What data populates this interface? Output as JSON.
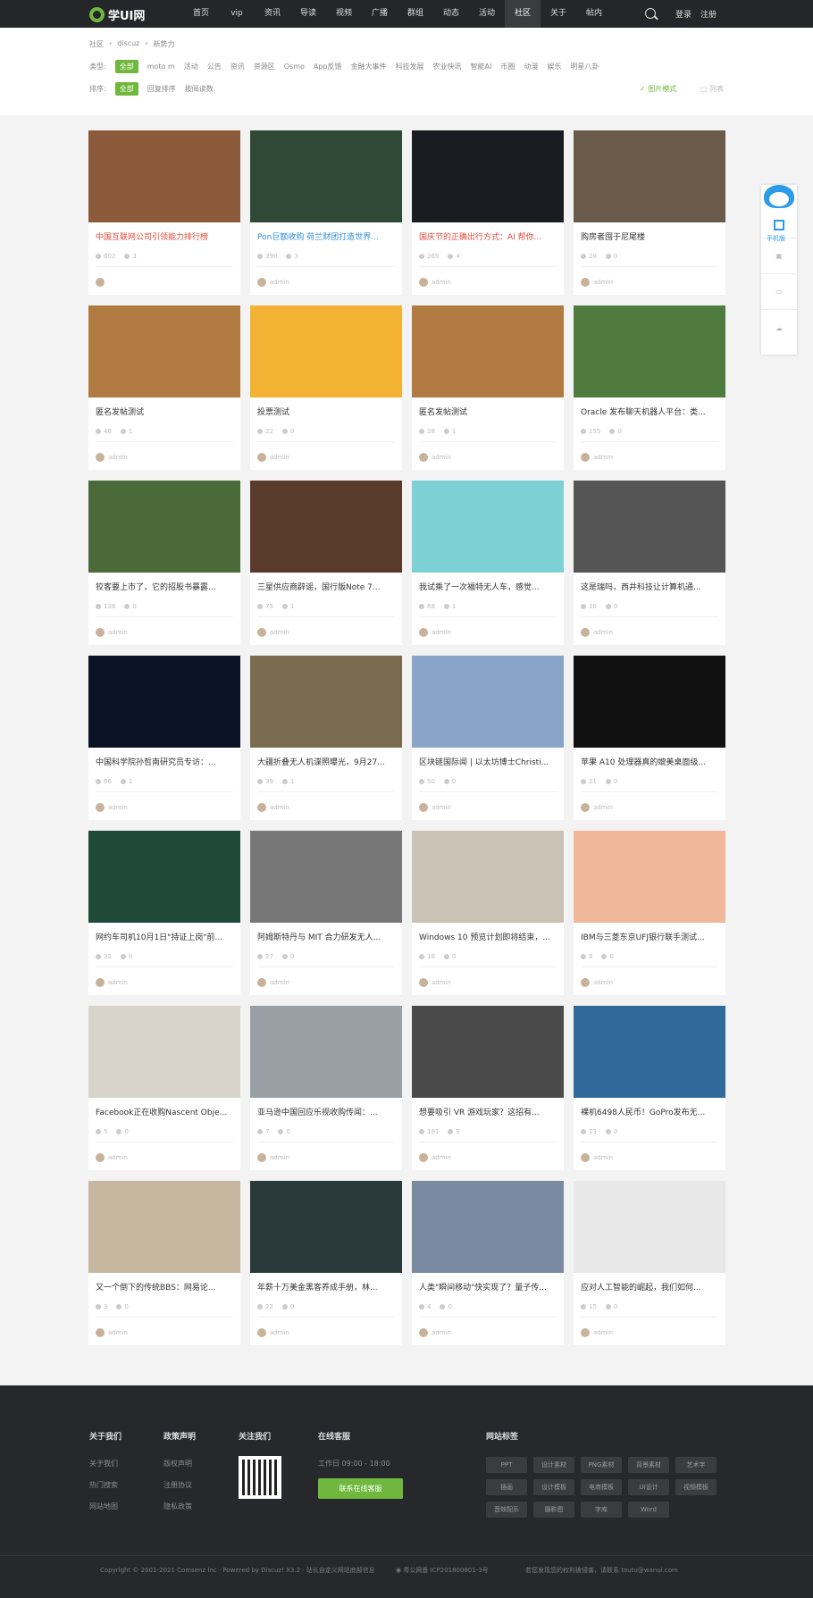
{
  "site": {
    "logo": "学UI网"
  },
  "nav": [
    "首页",
    "vip",
    "资讯",
    "导读",
    "视频",
    "广播",
    "群组",
    "动态",
    "活动",
    "社区",
    "关于",
    "帖内"
  ],
  "header": {
    "login": "登录",
    "register": "注册"
  },
  "breadcrumb": [
    "社区",
    "discuz",
    "新势力"
  ],
  "filters": {
    "type_label": "类型:",
    "types": [
      "全部",
      "moto m",
      "活动",
      "公告",
      "资讯",
      "资源区",
      "Osmo",
      "App反馈",
      "金融大事件",
      "科技发展",
      "农业快讯",
      "智能AI",
      "币圈",
      "动漫",
      "娱乐",
      "明星八卦"
    ],
    "sort_label": "排序:",
    "sorts": [
      "全部",
      "回复排序",
      "按阅读数"
    ],
    "view_image": "图片模式",
    "view_list": "列表"
  },
  "cards": [
    {
      "title": "中国互联网公司引领能力排行榜",
      "views": "602",
      "replies": "3",
      "author": "",
      "style": "hot"
    },
    {
      "title": "Pon巨额收购 荷兰财团打造世界...",
      "views": "390",
      "replies": "3",
      "author": "admin",
      "style": "blue"
    },
    {
      "title": "国庆节的正确出行方式：AI 帮你...",
      "views": "269",
      "replies": "4",
      "author": "admin",
      "style": "hot"
    },
    {
      "title": "购房者囤于尼尾楼",
      "views": "28",
      "replies": "0",
      "author": "admin",
      "style": ""
    },
    {
      "title": "匿名发帖测试",
      "views": "48",
      "replies": "1",
      "author": "admin",
      "style": ""
    },
    {
      "title": "投票测试",
      "views": "22",
      "replies": "0",
      "author": "admin",
      "style": ""
    },
    {
      "title": "匿名发帖测试",
      "views": "28",
      "replies": "1",
      "author": "admin",
      "style": ""
    },
    {
      "title": "Oracle 发布聊天机器人平台：类...",
      "views": "155",
      "replies": "0",
      "author": "admin",
      "style": ""
    },
    {
      "title": "狡客要上市了，它的招股书暴露...",
      "views": "138",
      "replies": "0",
      "author": "admin",
      "style": ""
    },
    {
      "title": "三星供应商辟谣，国行版Note 7...",
      "views": "75",
      "replies": "1",
      "author": "admin",
      "style": ""
    },
    {
      "title": "我试乘了一次福特无人车，感觉...",
      "views": "68",
      "replies": "1",
      "author": "admin",
      "style": ""
    },
    {
      "title": "这是瑞吗，西井科技让计算机通...",
      "views": "30",
      "replies": "0",
      "author": "admin",
      "style": ""
    },
    {
      "title": "中国科学院孙哲南研究员专访：...",
      "views": "66",
      "replies": "1",
      "author": "admin",
      "style": ""
    },
    {
      "title": "大疆折叠无人机谍照曝光，9月27...",
      "views": "39",
      "replies": "1",
      "author": "admin",
      "style": ""
    },
    {
      "title": "区块链国际闻 | 以太坊博士Christi...",
      "views": "50",
      "replies": "0",
      "author": "admin",
      "style": ""
    },
    {
      "title": "苹果 A10 处理器真的媲美桌面级...",
      "views": "21",
      "replies": "0",
      "author": "admin",
      "style": ""
    },
    {
      "title": "网约车司机10月1日\"持证上岗\"前...",
      "views": "32",
      "replies": "0",
      "author": "admin",
      "style": ""
    },
    {
      "title": "阿姆斯特丹与 MIT 合力研发无人...",
      "views": "27",
      "replies": "0",
      "author": "admin",
      "style": ""
    },
    {
      "title": "Windows 10 预览计划即将结束，...",
      "views": "18",
      "replies": "0",
      "author": "admin",
      "style": ""
    },
    {
      "title": "IBM与三菱东京UFJ银行联手测试...",
      "views": "8",
      "replies": "0",
      "author": "admin",
      "style": ""
    },
    {
      "title": "Facebook正在收购Nascent Obje...",
      "views": "5",
      "replies": "0",
      "author": "admin",
      "style": ""
    },
    {
      "title": "亚马逊中国回应乐视收购传闻：...",
      "views": "7",
      "replies": "0",
      "author": "admin",
      "style": ""
    },
    {
      "title": "想要吸引 VR 游戏玩家？这招有...",
      "views": "191",
      "replies": "3",
      "author": "admin",
      "style": ""
    },
    {
      "title": "裸机6498人民币！GoPro发布无...",
      "views": "23",
      "replies": "0",
      "author": "admin",
      "style": ""
    },
    {
      "title": "又一个倒下的传统BBS：网易论...",
      "views": "3",
      "replies": "0",
      "author": "admin",
      "style": ""
    },
    {
      "title": "年薪十万美金黑客养成手册，林...",
      "views": "22",
      "replies": "0",
      "author": "admin",
      "style": ""
    },
    {
      "title": "人类\"瞬间移动\"快实现了？量子传...",
      "views": "4",
      "replies": "0",
      "author": "admin",
      "style": ""
    },
    {
      "title": "应对人工智能的崛起，我们如何...",
      "views": "15",
      "replies": "0",
      "author": "admin",
      "style": ""
    }
  ],
  "thumb_colors": [
    "#8a5a3a",
    "#2e4a36",
    "#1b1b22",
    "#6a5a4a",
    "#b07a40",
    "#f3b234",
    "#b07a40",
    "#4f7c3e",
    "#4a6a3a",
    "#5a3a2a",
    "#7dd1d6",
    "#555555",
    "#0b1226",
    "#7a6a50",
    "#8aa3c9",
    "#111111",
    "#1f4a3a",
    "#777777",
    "#c9c2b5",
    "#f0b79a",
    "#d8d4cc",
    "#98a0a6",
    "#4a4a4a",
    "#2f6a9a",
    "#c8b7a0",
    "#2a3a3a",
    "#7a8aa0",
    "#e8e8e8"
  ],
  "sidebar": {
    "label": "手机版"
  },
  "footer": {
    "cols": [
      {
        "title": "关于我们",
        "links": [
          "关于我们",
          "热门搜索",
          "网站地图"
        ]
      },
      {
        "title": "政策声明",
        "links": [
          "版权声明",
          "注册协议",
          "隐私政策"
        ]
      },
      {
        "title": "关注我们",
        "links": []
      },
      {
        "title": "在线客服",
        "links": []
      }
    ],
    "hours": "工作日 09:00 - 18:00",
    "contact_button": "联系在线客服",
    "tags_title": "网站标签",
    "tags": [
      "PPT",
      "设计素材",
      "PNG素材",
      "背景素材",
      "艺术字",
      "插画",
      "设计模板",
      "电商模板",
      "UI设计",
      "视频模板",
      "音效配乐",
      "摄影图",
      "字库",
      "Word"
    ],
    "copyright": "Copyright © 2001-2021 Comsenz Inc · Powered by Discuz! X3.2 · 站长自定义网站底部信息",
    "icp": "粤公网备 ICP201800801-3号",
    "notice": "若您发现您的权利被侵害，请联系 toutu@wanui.com"
  }
}
